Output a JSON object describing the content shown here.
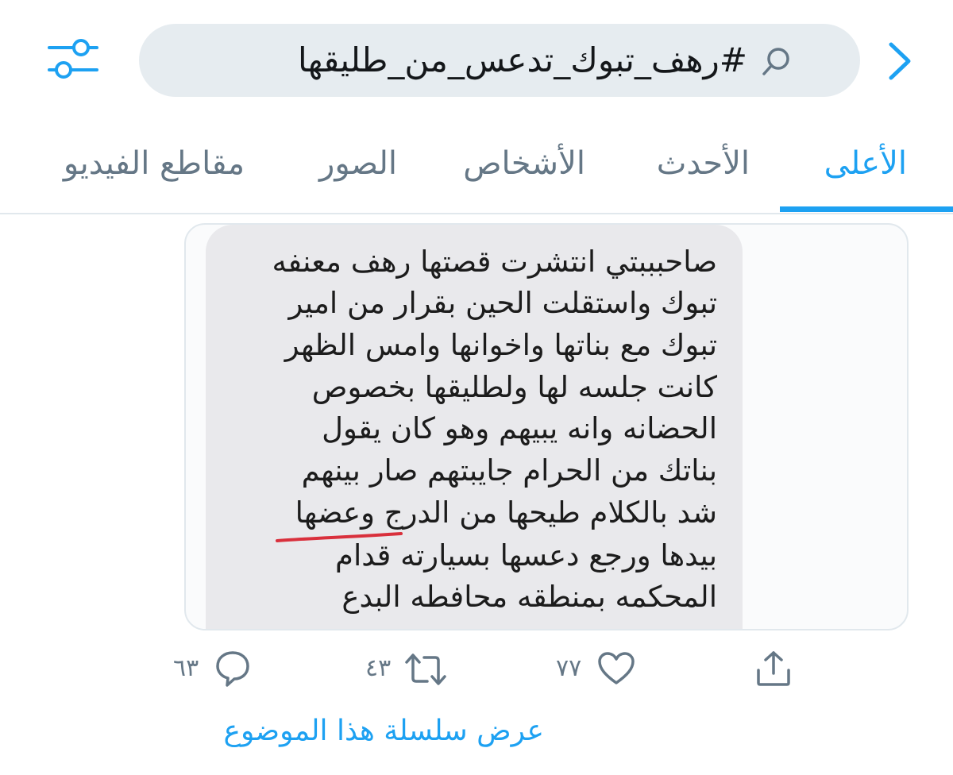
{
  "search": {
    "query": "#رهف_تبوك_تدعس_من_طليقها"
  },
  "tabs": [
    {
      "label": "الأعلى",
      "active": true
    },
    {
      "label": "الأحدث",
      "active": false
    },
    {
      "label": "الأشخاص",
      "active": false
    },
    {
      "label": "الصور",
      "active": false
    },
    {
      "label": "مقاطع الفيديو",
      "active": false
    }
  ],
  "tweet": {
    "image_text": [
      "صاحبببتي انتشرت قصتها رهف معنفه",
      "تبوك واستقلت الحين بقرار من امير",
      "تبوك مع بناتها واخوانها وامس الظهر",
      "كانت جلسه لها ولطليقها بخصوص",
      "الحضانه وانه يبيهم وهو كان يقول",
      "بناتك من الحرام جايبتهم صار بينهم",
      "شد بالكلام طيحها من الدرج وعضها",
      "بيدها ورجع دعسها بسيارته قدام",
      "المحكمه بمنطقه محافطه البدع"
    ],
    "actions": {
      "replies": "٦٣",
      "retweets": "٤٣",
      "likes": "٧٧"
    },
    "thread_link": "عرض سلسلة هذا الموضوع"
  },
  "colors": {
    "accent": "#1da1f2",
    "underline_annotation": "#d9303c",
    "muted": "#657786"
  }
}
